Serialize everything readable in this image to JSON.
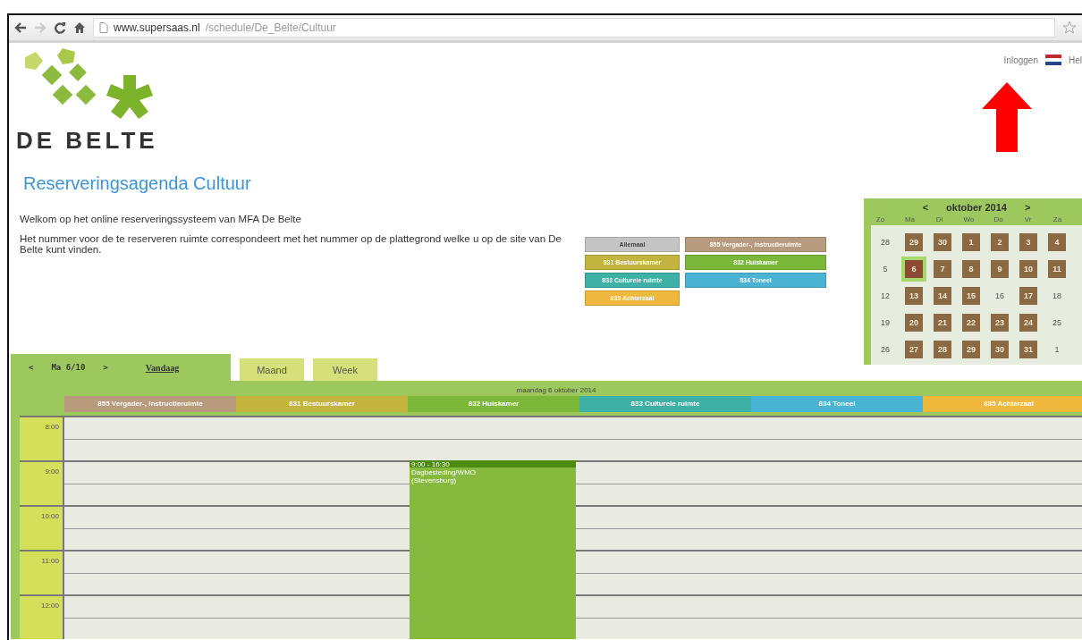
{
  "browser": {
    "url_host": "www.supersaas.nl",
    "url_path": "/schedule/De_Belte/Cultuur"
  },
  "top_links": [
    {
      "kind": "link",
      "label": "Inloggen"
    },
    {
      "kind": "flag"
    },
    {
      "kind": "link",
      "label": "Hel"
    }
  ],
  "logo": {
    "text": "DE BELTE"
  },
  "title": "Reserveringsagenda Cultuur",
  "intro": [
    "Welkom op het online reserveringssysteem van MFA De Belte",
    "Het nummer voor de te reserveren ruimte correspondeert met het nummer op de plattegrond welke u op de site van De Belte kunt vinden."
  ],
  "legend": [
    {
      "label": "Allemaal",
      "color": "#c4c4c4"
    },
    {
      "label": "855 Vergader-, instructieruimte",
      "color": "#b79b7c"
    },
    {
      "label": "831 Bestuurskamer",
      "color": "#c2b43c"
    },
    {
      "label": "832 Huiskamer",
      "color": "#7bb83a"
    },
    {
      "label": "833 Culturele ruimte",
      "color": "#3fb0a6"
    },
    {
      "label": "834 Toneel",
      "color": "#4ab3d4"
    },
    {
      "label": "835 Achterzaal",
      "color": "#f0b83c"
    }
  ],
  "calendar": {
    "month": "oktober 2014",
    "prev": "<",
    "next": ">",
    "weekdays": [
      "Zo",
      "Ma",
      "Di",
      "Wo",
      "Do",
      "Vr",
      "Za"
    ],
    "weeks": [
      {
        "first": "28",
        "days": [
          {
            "label": "29",
            "booked": true,
            "selected": false
          },
          {
            "label": "30",
            "booked": true,
            "selected": false
          },
          {
            "label": "1",
            "booked": true,
            "selected": false
          },
          {
            "label": "2",
            "booked": true,
            "selected": false
          },
          {
            "label": "3",
            "booked": true,
            "selected": false
          },
          {
            "label": "4",
            "booked": true,
            "selected": false
          }
        ]
      },
      {
        "first": "5",
        "days": [
          {
            "label": "6",
            "booked": true,
            "selected": true
          },
          {
            "label": "7",
            "booked": true,
            "selected": false
          },
          {
            "label": "8",
            "booked": true,
            "selected": false
          },
          {
            "label": "9",
            "booked": true,
            "selected": false
          },
          {
            "label": "10",
            "booked": true,
            "selected": false
          },
          {
            "label": "11",
            "booked": true,
            "selected": false
          }
        ]
      },
      {
        "first": "12",
        "days": [
          {
            "label": "13",
            "booked": true,
            "selected": false
          },
          {
            "label": "14",
            "booked": true,
            "selected": false
          },
          {
            "label": "15",
            "booked": true,
            "selected": false
          },
          {
            "label": "16",
            "booked": false,
            "selected": false
          },
          {
            "label": "17",
            "booked": true,
            "selected": false
          },
          {
            "label": "18",
            "booked": false,
            "selected": false
          }
        ]
      },
      {
        "first": "19",
        "days": [
          {
            "label": "20",
            "booked": true,
            "selected": false
          },
          {
            "label": "21",
            "booked": true,
            "selected": false
          },
          {
            "label": "22",
            "booked": true,
            "selected": false
          },
          {
            "label": "23",
            "booked": true,
            "selected": false
          },
          {
            "label": "24",
            "booked": true,
            "selected": false
          },
          {
            "label": "25",
            "booked": false,
            "selected": false
          }
        ]
      },
      {
        "first": "26",
        "days": [
          {
            "label": "27",
            "booked": true,
            "selected": false
          },
          {
            "label": "28",
            "booked": true,
            "selected": false
          },
          {
            "label": "29",
            "booked": true,
            "selected": false
          },
          {
            "label": "30",
            "booked": true,
            "selected": false
          },
          {
            "label": "31",
            "booked": true,
            "selected": false
          },
          {
            "label": "1",
            "booked": false,
            "selected": false
          }
        ]
      }
    ]
  },
  "schedule": {
    "nav": {
      "prev": "<",
      "date": "Ma 6/10",
      "next": ">",
      "today": "Vandaag"
    },
    "tabs": [
      {
        "label": "Maand",
        "selected": false
      },
      {
        "label": "Week",
        "selected": false
      }
    ],
    "day_title": "maandag 6 oktober 2014",
    "rooms": [
      {
        "name": "855 Vergader-, instructieruimte",
        "color": "#b79b7c"
      },
      {
        "name": "831 Bestuurskamer",
        "color": "#c2b43c"
      },
      {
        "name": "832 Huiskamer",
        "color": "#7bb83a",
        "bookings": [
          {
            "time": "9:00 - 16:30",
            "lines": [
              "Dagbesteding/WMO",
              "(Stevensburg)"
            ]
          }
        ]
      },
      {
        "name": "833 Culturele ruimte",
        "color": "#3fb0a6"
      },
      {
        "name": "834 Toneel",
        "color": "#4ab3d4"
      },
      {
        "name": "835 Achterzaal",
        "color": "#f0b83c"
      }
    ],
    "times": [
      "8:00",
      "9:00",
      "10:00",
      "11:00",
      "12:00"
    ]
  }
}
